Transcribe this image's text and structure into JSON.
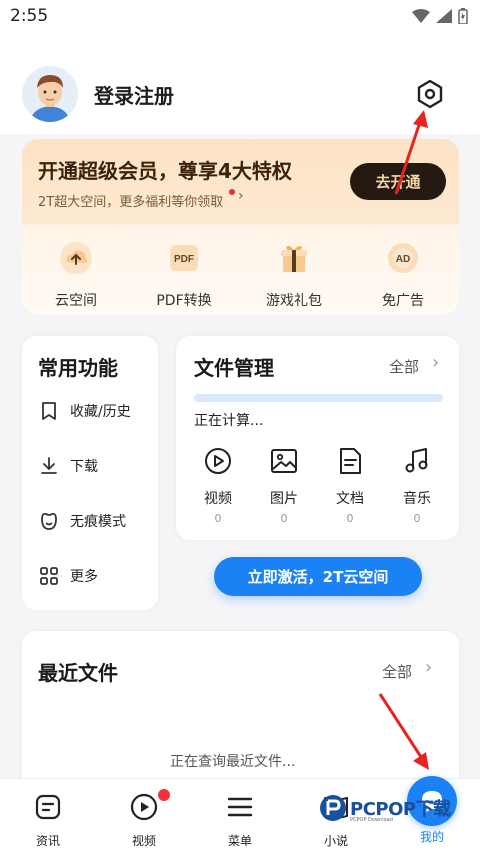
{
  "status_bar": {
    "time": "2:55"
  },
  "header": {
    "login_text": "登录注册"
  },
  "vip": {
    "title": "开通超级会员，尊享4大特权",
    "subtitle": "2T超大空间，更多福利等你领取",
    "button": "去开通",
    "perks": [
      {
        "icon": "cloud-upload-icon",
        "label": "云空间"
      },
      {
        "icon": "pdf-icon",
        "label": "PDF转换",
        "badge": "PDF"
      },
      {
        "icon": "gift-icon",
        "label": "游戏礼包"
      },
      {
        "icon": "ad-icon",
        "label": "免广告",
        "badge": "AD"
      }
    ]
  },
  "common": {
    "title": "常用功能",
    "items": [
      {
        "icon": "bookmark-icon",
        "label": "收藏/历史"
      },
      {
        "icon": "download-icon",
        "label": "下载"
      },
      {
        "icon": "incognito-icon",
        "label": "无痕模式"
      },
      {
        "icon": "grid-icon",
        "label": "更多"
      }
    ]
  },
  "files": {
    "title": "文件管理",
    "all_label": "全部",
    "chevron": "›",
    "status": "正在计算...",
    "progress": 1.0,
    "types": [
      {
        "icon": "video-icon",
        "label": "视频",
        "count": "0"
      },
      {
        "icon": "image-icon",
        "label": "图片",
        "count": "0"
      },
      {
        "icon": "document-icon",
        "label": "文档",
        "count": "0"
      },
      {
        "icon": "music-icon",
        "label": "音乐",
        "count": "0"
      }
    ],
    "activate": "立即激活，2T云空间"
  },
  "recent": {
    "title": "最近文件",
    "all_label": "全部",
    "chevron": "›",
    "loading": "正在查询最近文件..."
  },
  "nav": {
    "items": [
      {
        "icon": "news-icon",
        "label": "资讯"
      },
      {
        "icon": "video-play-icon",
        "label": "视频"
      },
      {
        "icon": "menu-icon",
        "label": "菜单"
      },
      {
        "icon": "novel-icon",
        "label": "小说"
      },
      {
        "icon": "profile-icon",
        "label": "我的"
      }
    ]
  },
  "watermark": {
    "brand": "PCPOP下载",
    "sub": "PCPOP Download"
  },
  "colors": {
    "accent": "#1a82f5",
    "vip_dark": "#241a12",
    "vip_gold": "#f6d6a8",
    "active_nav": "#1a82f5"
  }
}
